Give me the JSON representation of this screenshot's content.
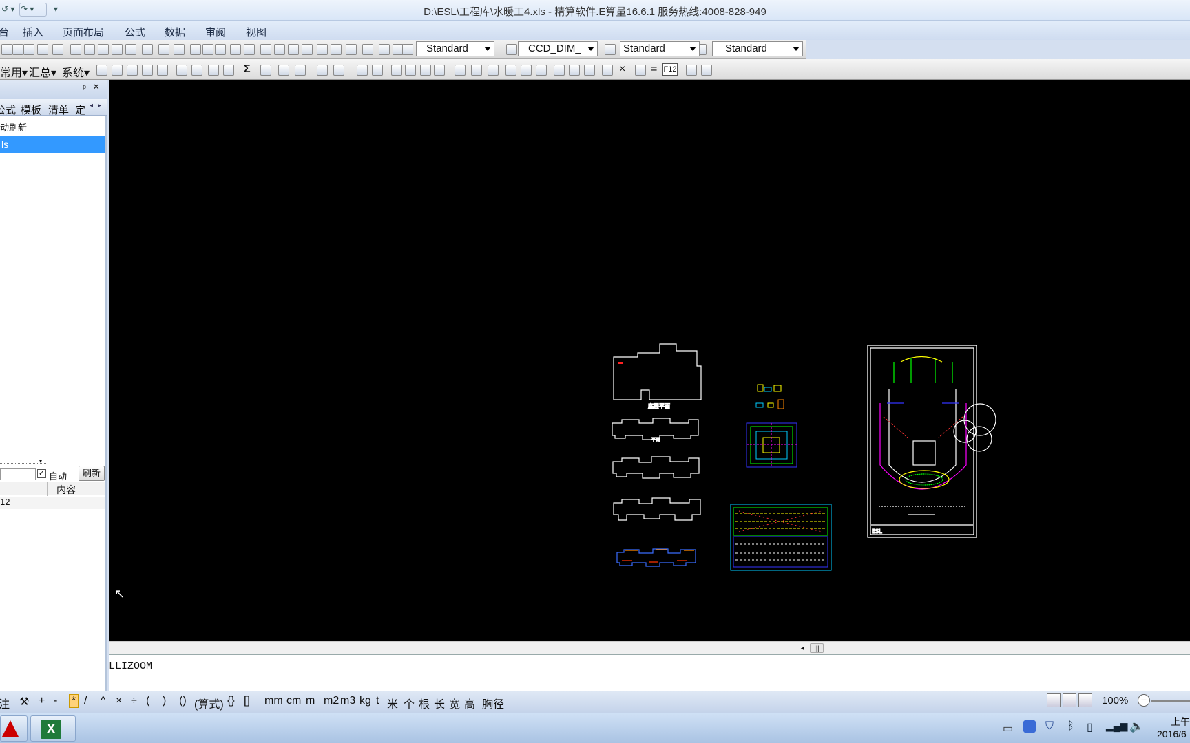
{
  "window": {
    "title": "D:\\ESL\\工程库\\水暖工4.xls - 精算软件.E算量16.6.1 服务热线:4008-828-949"
  },
  "menu": [
    "插入",
    "页面布局",
    "公式",
    "数据",
    "审阅",
    "视图"
  ],
  "toolbar1": {
    "combo_text_style": "Standard",
    "combo_dim_style": "CCD_DIM_",
    "combo_table_style": "Standard",
    "combo_multileader_style": "Standard"
  },
  "toolbar2": {
    "menu_common": "常用",
    "menu_summary": "汇总",
    "menu_system": "系统",
    "sigma": "Σ",
    "times": "×",
    "equals": "=",
    "f12": "F12"
  },
  "leftpanel": {
    "pin": "ᵖ",
    "close": "×",
    "tabs": [
      "公式",
      "模板",
      "清单",
      "定"
    ],
    "refresh_label": "动刷新",
    "selected_item": "ls",
    "auto_label": "自动",
    "refresh_button": "刷新",
    "column_content": "内容",
    "row_value": "12"
  },
  "cad": {
    "command_line": "LLIZOOM"
  },
  "statusbar": {
    "note": "注",
    "symbols": [
      "+",
      "-",
      "*",
      "/",
      "^",
      "×",
      "÷",
      "(",
      ")",
      "()",
      "(算式)",
      "{}",
      "[]",
      "mm",
      "cm",
      "m",
      "m2",
      "m3",
      "kg",
      "t",
      "米",
      "个",
      "根",
      "长",
      "宽",
      "高",
      "胸径"
    ],
    "zoom": "100%"
  },
  "taskbar": {
    "clock_time": "上午",
    "clock_date": "2016/6"
  }
}
